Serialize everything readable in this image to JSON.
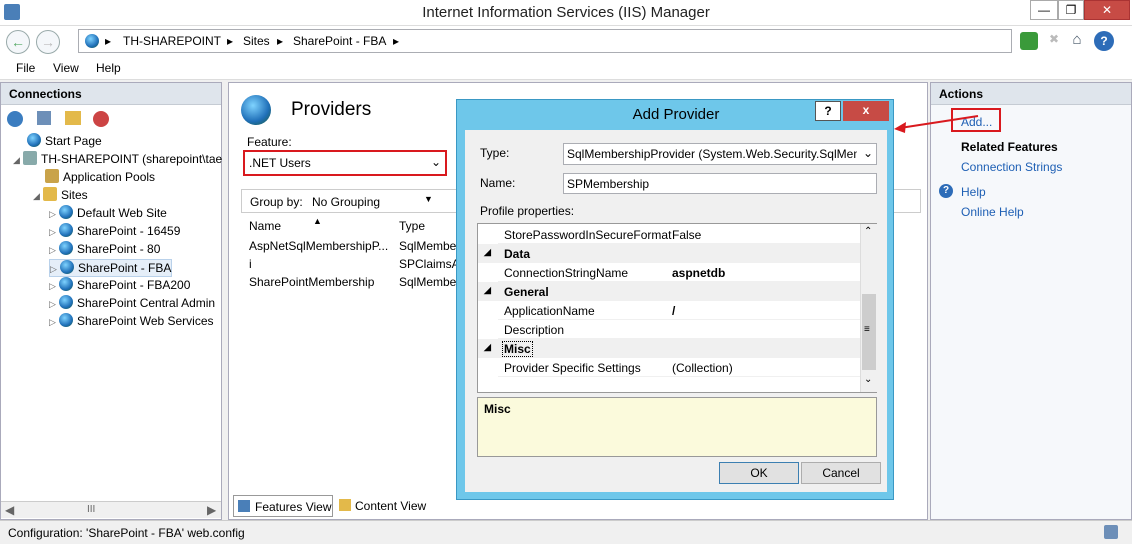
{
  "window": {
    "title": "Internet Information Services (IIS) Manager"
  },
  "breadcrumb": [
    "TH-SHAREPOINT",
    "Sites",
    "SharePoint - FBA"
  ],
  "menu": [
    "File",
    "View",
    "Help"
  ],
  "connections": {
    "header": "Connections",
    "tree": [
      {
        "label": "Start Page",
        "level": 1
      },
      {
        "label": "TH-SHAREPOINT (sharepoint\\tae",
        "level": 0
      },
      {
        "label": "Application Pools",
        "level": 2
      },
      {
        "label": "Sites",
        "level": 2
      },
      {
        "label": "Default Web Site",
        "level": 3
      },
      {
        "label": "SharePoint - 16459",
        "level": 3
      },
      {
        "label": "SharePoint - 80",
        "level": 3
      },
      {
        "label": "SharePoint - FBA",
        "level": 3
      },
      {
        "label": "SharePoint - FBA200",
        "level": 3
      },
      {
        "label": "SharePoint Central Admin",
        "level": 3
      },
      {
        "label": "SharePoint Web Services",
        "level": 3
      }
    ],
    "hscroll_thumb": "III"
  },
  "center": {
    "title": "Providers",
    "feature_label": "Feature:",
    "feature_value": ".NET Users",
    "groupby_label": "Group by:",
    "groupby_value": "No Grouping",
    "columns": [
      "Name",
      "Type"
    ],
    "rows": [
      {
        "name": "AspNetSqlMembershipP...",
        "type": "SqlMembe"
      },
      {
        "name": "i",
        "type": "SPClaimsA"
      },
      {
        "name": "SharePointMembership",
        "type": "SqlMembe"
      }
    ],
    "features_view": "Features View",
    "content_view": "Content View"
  },
  "actions": {
    "header": "Actions",
    "add": "Add...",
    "related": "Related Features",
    "connection_strings": "Connection Strings",
    "help": "Help",
    "online_help": "Online Help"
  },
  "dialog": {
    "title": "Add Provider",
    "help_btn": "?",
    "close_btn": "x",
    "type_label": "Type:",
    "type_value": "SqlMembershipProvider (System.Web.Security.SqlMem",
    "name_label": "Name:",
    "name_value": "SPMembership",
    "profile_label": "Profile properties:",
    "grid": {
      "top_row": {
        "k": "StorePasswordInSecureFormat",
        "v": "False"
      },
      "cat_data": "Data",
      "conn_name": {
        "k": "ConnectionStringName",
        "v": "aspnetdb"
      },
      "cat_general": "General",
      "app_name": {
        "k": "ApplicationName",
        "v": "/"
      },
      "description": {
        "k": "Description",
        "v": ""
      },
      "cat_misc": "Misc",
      "provider_settings": {
        "k": "Provider Specific Settings",
        "v": "(Collection)"
      }
    },
    "description_box": "Misc",
    "ok": "OK",
    "cancel": "Cancel"
  },
  "status": {
    "text": "Configuration: 'SharePoint - FBA' web.config"
  }
}
